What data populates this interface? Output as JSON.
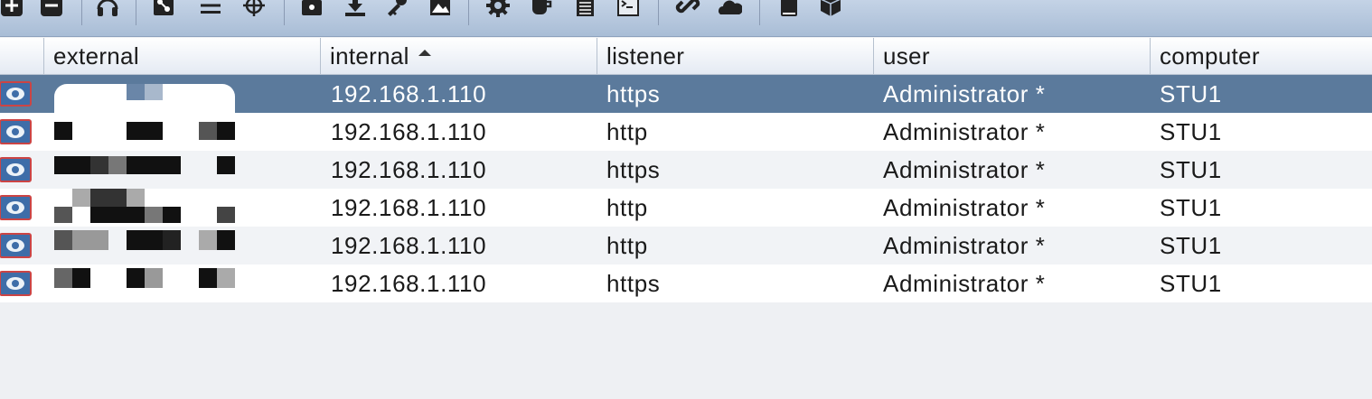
{
  "toolbar": {
    "buttons": [
      "add-icon",
      "remove-icon",
      "headphones-icon",
      "targets-icon",
      "list-icon",
      "crosshair-icon",
      "folder-icon",
      "download-icon",
      "key-icon",
      "image-icon",
      "gear-icon",
      "coffee-icon",
      "notepad-icon",
      "console-icon",
      "link-icon",
      "cloud-icon",
      "book-icon",
      "package-icon"
    ]
  },
  "table": {
    "columns": {
      "external": "external",
      "internal": "internal",
      "listener": "listener",
      "user": "user",
      "computer": "computer"
    },
    "sorted_by": "internal",
    "rows": [
      {
        "internal": "192.168.1.110",
        "listener": "https",
        "user": "Administrator *",
        "computer": "STU1",
        "selected": true
      },
      {
        "internal": "192.168.1.110",
        "listener": "http",
        "user": "Administrator *",
        "computer": "STU1",
        "selected": false
      },
      {
        "internal": "192.168.1.110",
        "listener": "https",
        "user": "Administrator *",
        "computer": "STU1",
        "selected": false
      },
      {
        "internal": "192.168.1.110",
        "listener": "http",
        "user": "Administrator *",
        "computer": "STU1",
        "selected": false
      },
      {
        "internal": "192.168.1.110",
        "listener": "http",
        "user": "Administrator *",
        "computer": "STU1",
        "selected": false
      },
      {
        "internal": "192.168.1.110",
        "listener": "https",
        "user": "Administrator *",
        "computer": "STU1",
        "selected": false
      }
    ]
  },
  "colors": {
    "selected_row": "#5b7a9c",
    "toolbar": "#b4c6dc"
  }
}
